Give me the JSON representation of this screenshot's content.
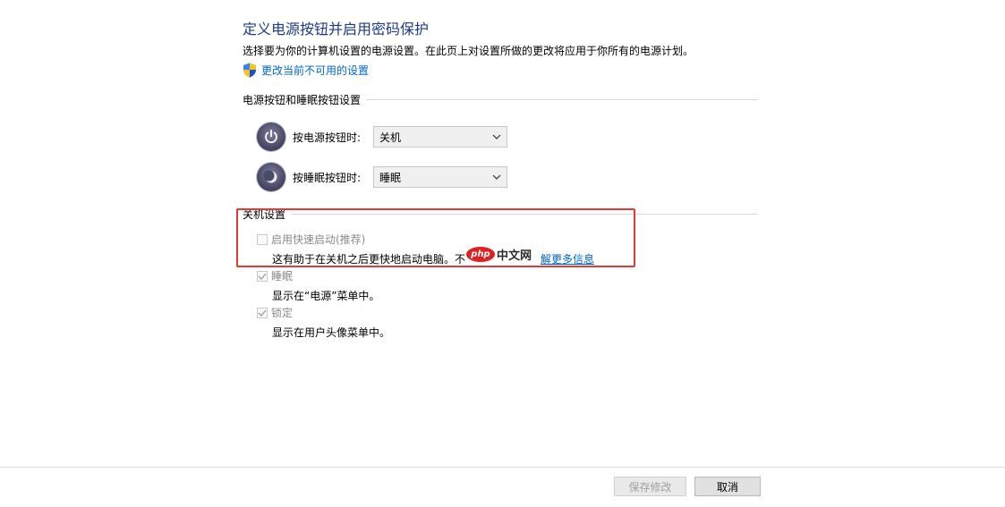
{
  "header": {
    "title": "定义电源按钮并启用密码保护",
    "subtitle": "选择要为你的计算机设置的电源设置。在此页上对设置所做的更改将应用于你所有的电源计划。",
    "change_settings_link": "更改当前不可用的设置",
    "link_icon": "uac-shield-icon"
  },
  "power_buttons_section": {
    "title": "电源按钮和睡眠按钮设置",
    "power_button": {
      "label": "按电源按钮时:",
      "value": "关机",
      "icon": "power-icon"
    },
    "sleep_button": {
      "label": "按睡眠按钮时:",
      "value": "睡眠",
      "icon": "moon-icon"
    }
  },
  "shutdown_section": {
    "title": "关机设置",
    "options": [
      {
        "name": "启用快速启动(推荐)",
        "checked": false,
        "desc": "这有助于在关机之后更快地启动电脑。不",
        "link": "解更多信息"
      },
      {
        "name": "睡眠",
        "checked": true,
        "desc": "显示在“电源”菜单中。"
      },
      {
        "name": "锁定",
        "checked": true,
        "desc": "显示在用户头像菜单中。"
      }
    ]
  },
  "watermark": {
    "badge": "php",
    "text": "中文网"
  },
  "footer": {
    "save_label": "保存修改",
    "cancel_label": "取消"
  },
  "colors": {
    "title": "#1e3a8a",
    "link": "#0066cc",
    "highlight_border": "#e53935"
  }
}
